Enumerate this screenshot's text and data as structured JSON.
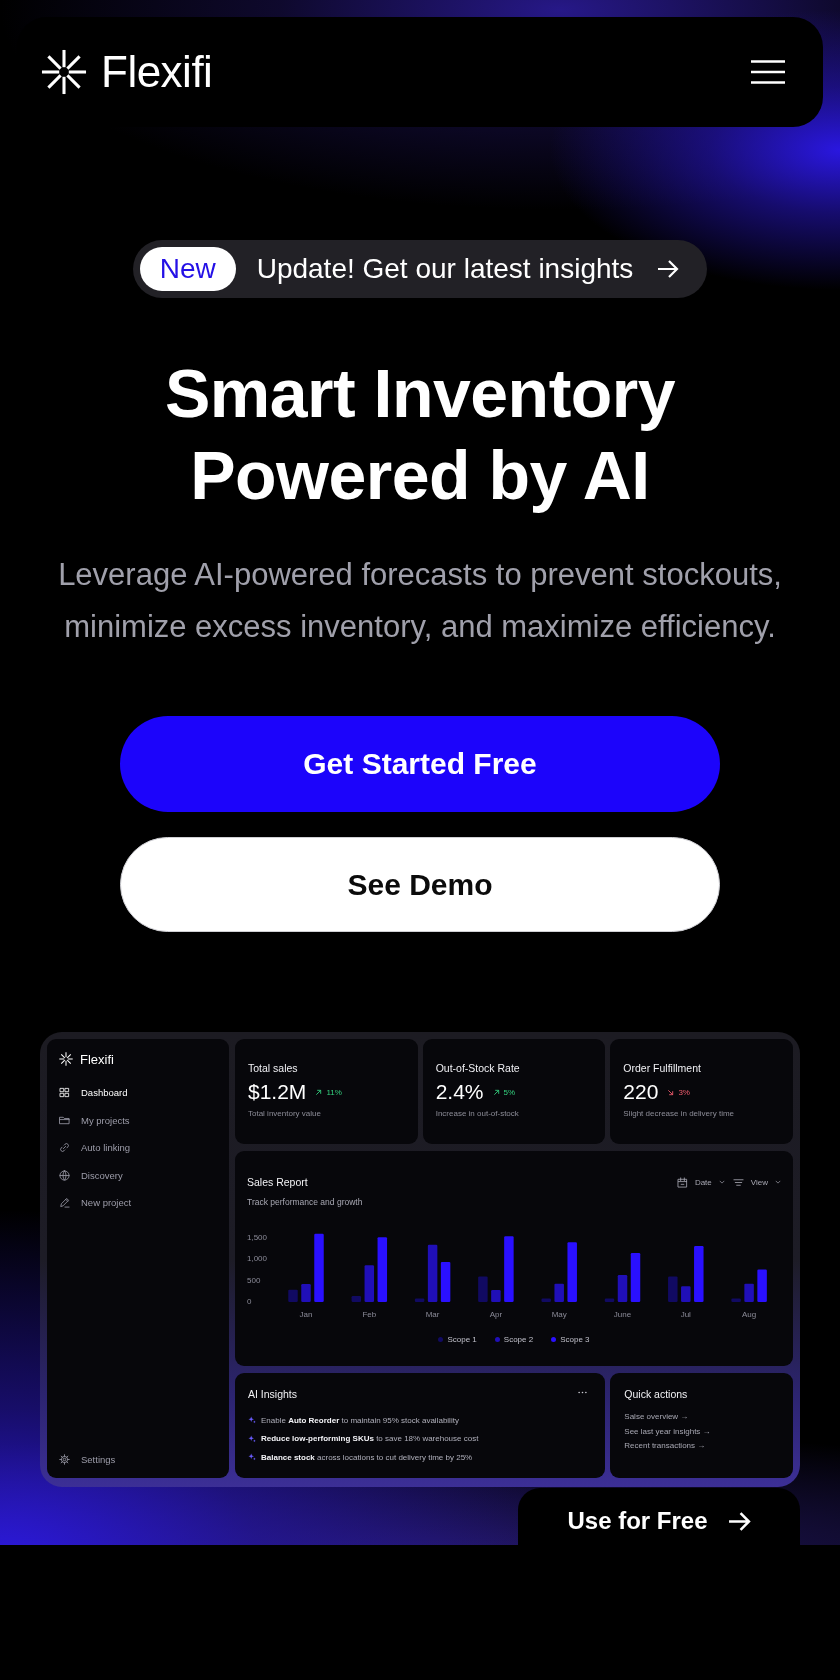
{
  "header": {
    "brand": "Flexifi"
  },
  "announcement": {
    "badge": "New",
    "text": "Update! Get our latest insights"
  },
  "hero": {
    "title": "Smart Inventory Powered by AI",
    "subtitle": "Leverage AI-powered forecasts to prevent stockouts, minimize excess inventory, and maximize efficiency."
  },
  "buttons": [
    {
      "label": "Get Started Free",
      "kind": "primary"
    },
    {
      "label": "See Demo",
      "kind": "secondary"
    }
  ],
  "dashboard": {
    "brand": "Flexifi",
    "nav": [
      {
        "label": "Dashboard",
        "selected": true
      },
      {
        "label": "My projects",
        "selected": false
      },
      {
        "label": "Auto linking",
        "selected": false
      },
      {
        "label": "Discovery",
        "selected": false
      },
      {
        "label": "New project",
        "selected": false
      }
    ],
    "settings": "Settings",
    "stats": [
      {
        "title": "Total sales",
        "value": "$1.2M",
        "change": "11%",
        "rising": true,
        "note": "Total inventory value"
      },
      {
        "title": "Out-of-Stock Rate",
        "value": "2.4%",
        "change": "5%",
        "rising": true,
        "note": "Increase in out-of-stock"
      },
      {
        "title": "Order Fulfillment",
        "value": "220",
        "change": "3%",
        "rising": false,
        "note": "Slight decrease in delivery time"
      }
    ],
    "sales_report": {
      "title": "Sales Report",
      "subtitle": "Track performance and growth",
      "controls": [
        "Date",
        "View"
      ],
      "chart_data": {
        "type": "bar",
        "categories": [
          "Jan",
          "Feb",
          "Mar",
          "Apr",
          "May",
          "June",
          "Jul",
          "Aug"
        ],
        "series": [
          {
            "name": "Scope 1",
            "color": "#110a62",
            "values": [
              290,
              140,
              80,
              600,
              80,
              80,
              600,
              80
            ]
          },
          {
            "name": "Scope 2",
            "color": "#200fb8",
            "values": [
              420,
              860,
              1340,
              280,
              430,
              630,
              370,
              430
            ]
          },
          {
            "name": "Scope 3",
            "color": "#2a10ff",
            "values": [
              1600,
              1520,
              940,
              1540,
              1400,
              1150,
              1310,
              760
            ]
          }
        ],
        "ylim": [
          0,
          1650
        ],
        "yticks": [
          0,
          {
            "value": 500,
            "label": "500"
          },
          {
            "value": 1000,
            "label": "1,000"
          },
          {
            "value": 1500,
            "label": "1,500"
          }
        ]
      }
    },
    "insights": {
      "title": "AI Insights",
      "items": [
        "Enable **Auto Reorder** to maintain 95% stock availability",
        "**Reduce low-performing SKUs** to save 18% warehouse cost",
        "**Balance stock** across locations to cut delivery time by 25%"
      ]
    },
    "quick_actions": {
      "title": "Quick actions",
      "links": [
        "Salse overview →",
        "See last year insights →",
        "Recent transactions →"
      ]
    }
  },
  "floating_button": {
    "label": "Use for Free"
  }
}
